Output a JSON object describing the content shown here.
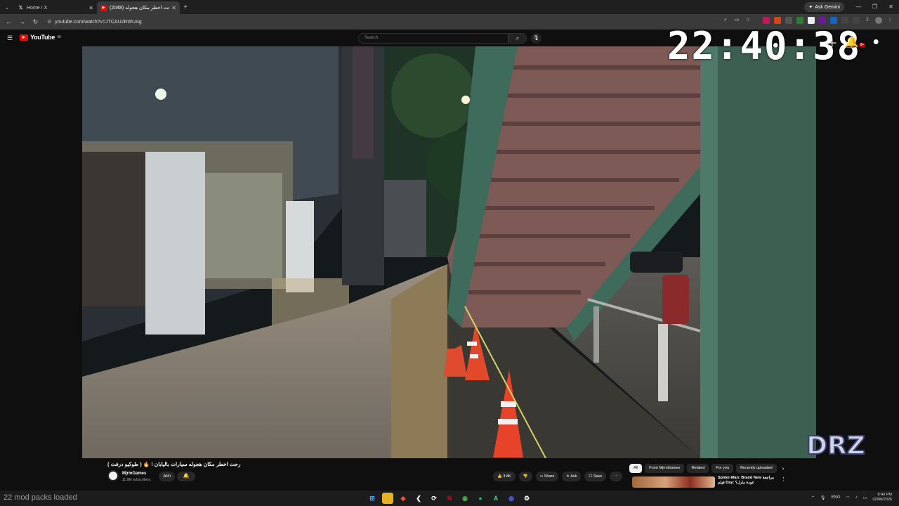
{
  "browser": {
    "tabs": [
      {
        "title": "Home / X",
        "icon": "x-icon"
      },
      {
        "title": "(2048) رحت اخطر مكان هجوله ...",
        "icon": "youtube-icon"
      }
    ],
    "url": "youtube.com/watch?v=JTCAU2RWUAg",
    "gemini_label": "Ask Gemini"
  },
  "youtube": {
    "logo_text": "YouTube",
    "logo_region": "AE",
    "search_placeholder": "Search",
    "notif_count": "9+"
  },
  "overlay": {
    "clock": "22:40:38",
    "logo_text": "DRZ"
  },
  "video_info": {
    "title": "رحت اخطر مكان هجوله سيارات باليابان ! 🔥 ( طوكيو درفت )",
    "channel": "MjrmGames",
    "subscribers": "11.8M subscribers",
    "join_label": "Join",
    "actions": [
      {
        "icon": "like-icon",
        "label": "3.8K"
      },
      {
        "icon": "dislike-icon",
        "label": ""
      },
      {
        "icon": "share-icon",
        "label": "Share"
      },
      {
        "icon": "ask-icon",
        "label": "Ask"
      },
      {
        "icon": "save-icon",
        "label": "Save"
      },
      {
        "icon": "more-icon",
        "label": "⋯"
      }
    ]
  },
  "recommendations": {
    "chips": [
      "All",
      "From MjrmGames",
      "Related",
      "For you",
      "Recently uploaded"
    ],
    "first_title": "Spider-Man: Brand New مراجعة فيلم Day: عودة مارل؟"
  },
  "taskbar": {
    "mod_text": "22 mod packs loaded",
    "lang": "ENG",
    "time": "8:40 PM",
    "date": "02/08/2026"
  }
}
